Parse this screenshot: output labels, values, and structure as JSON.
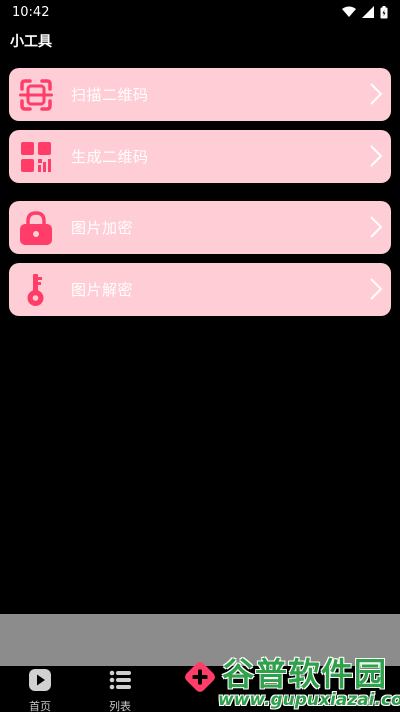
{
  "status_bar": {
    "time": "10:42",
    "icons": [
      "wifi-icon",
      "signal-icon",
      "battery-icon"
    ]
  },
  "header": {
    "title": "小工具"
  },
  "tools": [
    {
      "label": "扫描二维码",
      "icon": "scan-qr-icon"
    },
    {
      "label": "生成二维码",
      "icon": "qr-grid-icon"
    },
    {
      "label": "图片加密",
      "icon": "lock-icon"
    },
    {
      "label": "图片解密",
      "icon": "key-icon"
    }
  ],
  "bottom_nav": {
    "items": [
      {
        "label": "首页",
        "icon": "play-icon"
      },
      {
        "label": "列表",
        "icon": "list-icon"
      }
    ],
    "fab_icon": "plus-icon"
  },
  "watermark": {
    "title": "谷普软件园",
    "url": "www.gupuxiazai.com"
  },
  "colors": {
    "background": "#000000",
    "card": "#ffcdd6",
    "accent": "#ff3d68",
    "gray_bar": "#8c8c8c",
    "watermark": "#2fa14a"
  }
}
